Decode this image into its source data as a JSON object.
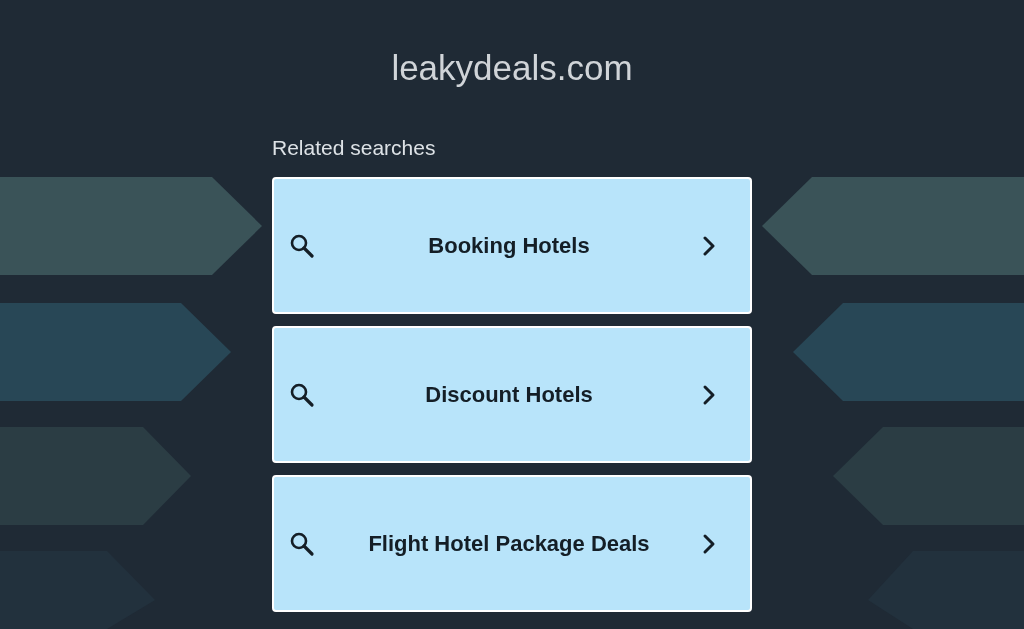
{
  "site_title": "leakydeals.com",
  "related_searches": {
    "heading": "Related searches",
    "items": [
      {
        "label": "Booking Hotels"
      },
      {
        "label": "Discount Hotels"
      },
      {
        "label": "Flight Hotel Package Deals"
      }
    ]
  }
}
